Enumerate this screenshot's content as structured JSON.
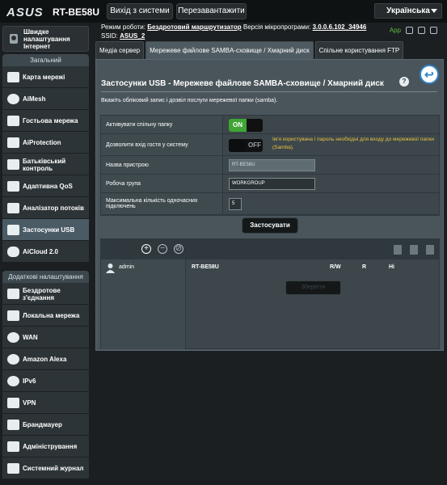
{
  "header": {
    "logo": "ASUS",
    "model": "RT-BE58U",
    "logout_label": "Вихід з системи",
    "reboot_label": "Перезавантажити",
    "language": "Українська"
  },
  "info": {
    "mode_label": "Режим роботи:",
    "mode_value": "Бездротовий маршрутизатор",
    "firmware_label": "Версія мікропрограми:",
    "firmware_value": "3.0.0.6.102_34946",
    "ssid_label": "SSID:",
    "ssid_value": "ASUS_2",
    "app_label": "App"
  },
  "sidebar": {
    "quick_setup": "Швидке налаштування Інтернет",
    "general_title": "Загальний",
    "general_items": [
      {
        "label": "Карта мережі",
        "icon": "network-map-icon"
      },
      {
        "label": "AiMesh",
        "icon": "aimesh-icon"
      },
      {
        "label": "Гостьова мережа",
        "icon": "guest-network-icon"
      },
      {
        "label": "AiProtection",
        "icon": "shield-icon"
      },
      {
        "label": "Батьківський контроль",
        "icon": "parental-control-icon"
      },
      {
        "label": "Адаптивна QoS",
        "icon": "qos-icon"
      },
      {
        "label": "Аналізатор потоків",
        "icon": "traffic-analyzer-icon"
      },
      {
        "label": "Застосунки USB",
        "icon": "usb-icon"
      },
      {
        "label": "AiCloud 2.0",
        "icon": "cloud-icon"
      }
    ],
    "advanced_title": "Додаткові налаштування",
    "advanced_items": [
      {
        "label": "Бездротове з'єднання",
        "icon": "wireless-icon"
      },
      {
        "label": "Локальна мережа",
        "icon": "lan-icon"
      },
      {
        "label": "WAN",
        "icon": "globe-icon"
      },
      {
        "label": "Amazon Alexa",
        "icon": "alexa-icon"
      },
      {
        "label": "IPv6",
        "icon": "ipv6-icon"
      },
      {
        "label": "VPN",
        "icon": "vpn-icon"
      },
      {
        "label": "Брандмауер",
        "icon": "firewall-icon"
      },
      {
        "label": "Адміністрування",
        "icon": "admin-icon"
      },
      {
        "label": "Системний журнал",
        "icon": "log-icon"
      }
    ]
  },
  "tabs": [
    "Медіа сервер",
    "Мережеве файлове SAMBA-сховище / Хмарний диск",
    "Спільне користування FTP"
  ],
  "panel": {
    "title": "Застосунки USB - Мережеве файлове SAMBA-сховище / Хмарний диск",
    "help": "?",
    "description": "Вкажіть обліковий запис і дозвіл послуги мережевої папки (samba).",
    "rows": {
      "share_label": "Активувати спільну папку",
      "share_state": "ON",
      "guest_label": "Дозволити вхід гостя у систему",
      "guest_state": "OFF",
      "guest_note": "Ім'я користувача і пароль необхідні для входу до мережевої папки (Samba).",
      "device_label": "Назва пристрою",
      "device_value": "RT-BE58U",
      "workgroup_label": "Робоча група",
      "workgroup_value": "WORKGROUP",
      "max_label": "Максимальна кількість одночасних підключень",
      "max_value": "5"
    },
    "apply_label": "Застосувати",
    "share": {
      "user": "admin",
      "device": "RT-BE58U",
      "col_rw": "R/W",
      "col_r": "R",
      "col_no": "Ні",
      "save_label": "Зберегти"
    }
  },
  "colors": {
    "accent_green": "#3fa535",
    "note_yellow": "#e8c23f",
    "active_menu": "#4a5b65"
  }
}
